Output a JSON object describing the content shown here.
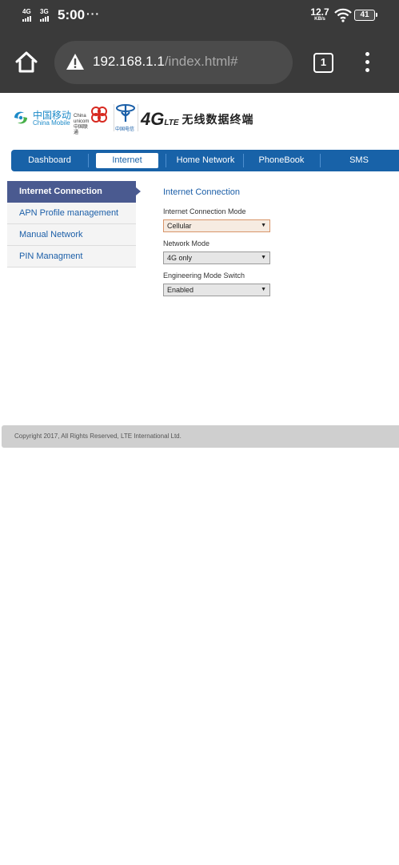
{
  "status_bar": {
    "net1_label": "4G",
    "net2_label": "3G",
    "time": "5:00",
    "overflow": "···",
    "speed_value": "12.7",
    "speed_unit": "KB/s",
    "wifi_icon": "wifi-icon",
    "battery": "41"
  },
  "browser": {
    "url_host": "192.168.1.1",
    "url_path": "/index.html#",
    "tab_count": "1",
    "home_icon": "home-icon",
    "warning_icon": "warning-icon",
    "menu_icon": "more-vert-icon"
  },
  "header": {
    "china_mobile_zh": "中国移动",
    "china_mobile_en": "China Mobile",
    "china_unicom_text": "China unicom中国联通",
    "china_telecom_text": "中国电信",
    "brand_4g": "4G",
    "brand_lte": "LTE",
    "brand_title": "无线数据终端"
  },
  "nav": {
    "items": [
      {
        "label": "Dashboard",
        "active": false
      },
      {
        "label": "Internet",
        "active": true
      },
      {
        "label": "Home Network",
        "active": false
      },
      {
        "label": "PhoneBook",
        "active": false
      },
      {
        "label": "SMS",
        "active": false
      }
    ]
  },
  "sidebar": {
    "items": [
      {
        "label": "Internet Connection",
        "active": true
      },
      {
        "label": "APN Profile management",
        "active": false
      },
      {
        "label": "Manual Network",
        "active": false
      },
      {
        "label": "PIN Managment",
        "active": false
      }
    ]
  },
  "content": {
    "title": "Internet Connection",
    "fields": [
      {
        "label": "Internet Connection Mode",
        "value": "Cellular"
      },
      {
        "label": "Network Mode",
        "value": "4G only"
      },
      {
        "label": "Engineering Mode Switch",
        "value": "Enabled"
      }
    ]
  },
  "footer": {
    "copyright": "Copyright 2017, All Rights Reserved, LTE International Ltd."
  },
  "colors": {
    "status_bg": "#3a3a3a",
    "nav_blue": "#1862a8",
    "sidebar_active": "#4a5a90",
    "link_blue": "#1c5fa8",
    "footer_bg": "#cfcfcf"
  }
}
